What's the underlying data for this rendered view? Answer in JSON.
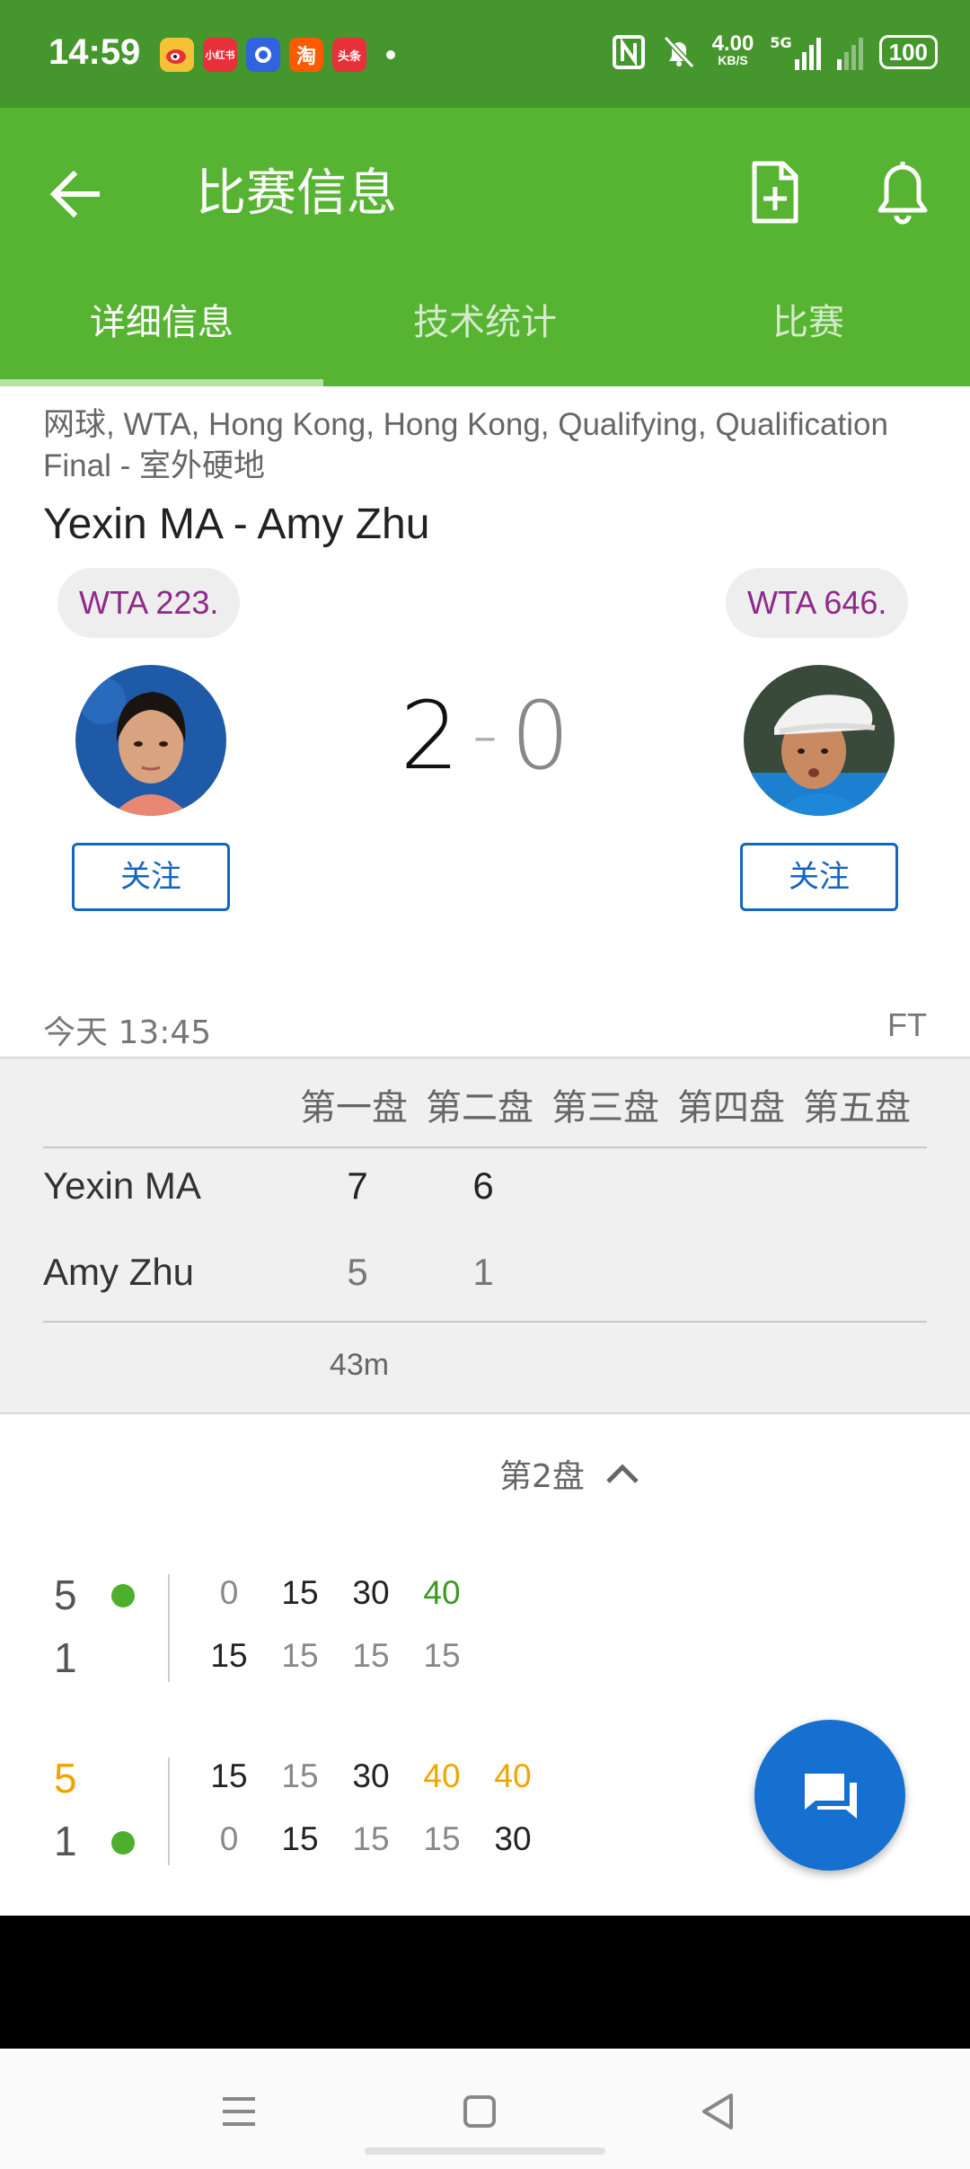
{
  "status_bar": {
    "time": "14:59",
    "apps": [
      {
        "name": "weibo-app-icon",
        "label": "",
        "color": "#f6c235"
      },
      {
        "name": "xiaohongshu-app-icon",
        "label": "小红书",
        "color": "#e8303a"
      },
      {
        "name": "baidu-app-icon",
        "label": "",
        "color": "#2f63e0"
      },
      {
        "name": "taobao-app-icon",
        "label": "淘",
        "color": "#ff5a00"
      },
      {
        "name": "toutiao-app-icon",
        "label": "头条",
        "color": "#e8303a"
      }
    ],
    "net_speed_value": "4.00",
    "net_speed_unit": "KB/S",
    "network": "5G",
    "battery": "100"
  },
  "app_bar": {
    "title": "比赛信息",
    "tabs": [
      {
        "label": "详细信息",
        "active": true
      },
      {
        "label": "技术统计",
        "active": false
      },
      {
        "label": "比赛",
        "active": false
      }
    ]
  },
  "match": {
    "subtitle": "网球, WTA, Hong Kong, Hong Kong, Qualifying, Qualification Final - 室外硬地",
    "title": "Yexin MA - Amy Zhu",
    "home": {
      "name": "Yexin MA",
      "rank": "WTA 223.",
      "follow_label": "关注"
    },
    "away": {
      "name": "Amy Zhu",
      "rank": "WTA 646.",
      "follow_label": "关注"
    },
    "score_home": "2",
    "score_sep": "-",
    "score_away": "0",
    "date": "今天 13:45",
    "status": "FT"
  },
  "sets": {
    "headers": [
      "第一盘",
      "第二盘",
      "第三盘",
      "第四盘",
      "第五盘"
    ],
    "rows": [
      {
        "name": "Yexin MA",
        "scores": [
          "7",
          "6"
        ]
      },
      {
        "name": "Amy Zhu",
        "scores": [
          "5",
          "1"
        ]
      }
    ],
    "duration": "43m"
  },
  "set_toggle": {
    "label": "第2盘"
  },
  "point_by_point": [
    {
      "top": {
        "games": "5",
        "serving": true,
        "points": [
          "0",
          "15",
          "30",
          "40"
        ]
      },
      "bottom": {
        "games": "1",
        "serving": false,
        "points": [
          "15",
          "15",
          "15",
          "15"
        ]
      }
    },
    {
      "top": {
        "games": "5",
        "serving": false,
        "points": [
          "15",
          "15",
          "30",
          "40",
          "40"
        ]
      },
      "bottom": {
        "games": "1",
        "serving": true,
        "points": [
          "0",
          "15",
          "15",
          "15",
          "30"
        ]
      }
    }
  ],
  "colors": {
    "status_bar": "#45962c",
    "app_bar": "#57b332",
    "rank_text": "#8e2a8a",
    "follow_blue": "#1565c0",
    "fab": "#1570d0",
    "game_point_green": "#3d9a24",
    "break_orange": "#f0a500"
  }
}
